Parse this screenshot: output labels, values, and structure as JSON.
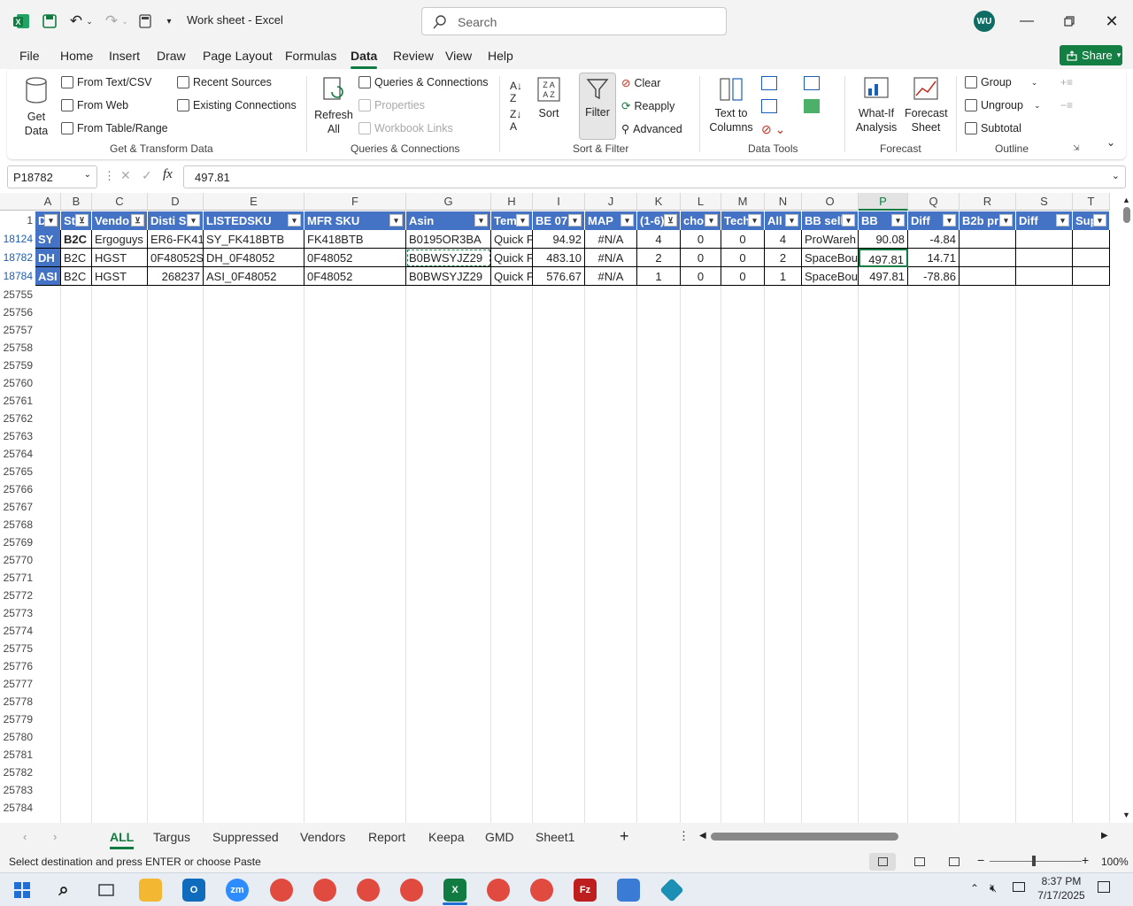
{
  "window": {
    "title": "Work sheet  -  Excel",
    "search_placeholder": "Search",
    "user_initials": "WU"
  },
  "menu": [
    "File",
    "Home",
    "Insert",
    "Draw",
    "Page Layout",
    "Formulas",
    "Data",
    "Review",
    "View",
    "Help"
  ],
  "active_menu": "Data",
  "share_label": "Share",
  "ribbon": {
    "get_data": "Get\nData",
    "from_text_csv": "From Text/CSV",
    "from_web": "From Web",
    "from_table_range": "From Table/Range",
    "recent_sources": "Recent Sources",
    "existing_connections": "Existing Connections",
    "group_get_transform": "Get & Transform Data",
    "refresh_all": "Refresh\nAll",
    "queries_connections": "Queries & Connections",
    "properties": "Properties",
    "workbook_links": "Workbook Links",
    "group_queries": "Queries & Connections",
    "sort": "Sort",
    "filter": "Filter",
    "clear": "Clear",
    "reapply": "Reapply",
    "advanced": "Advanced",
    "group_sort_filter": "Sort & Filter",
    "text_to_columns": "Text to\nColumns",
    "group_data_tools": "Data Tools",
    "what_if": "What-If\nAnalysis",
    "forecast_sheet": "Forecast\nSheet",
    "group_forecast": "Forecast",
    "group_btn": "Group",
    "ungroup": "Ungroup",
    "subtotal": "Subtotal",
    "group_outline": "Outline"
  },
  "formula_bar": {
    "name_box": "P18782",
    "formula": "497.81",
    "fx": "fx"
  },
  "columns": [
    "A",
    "B",
    "C",
    "D",
    "E",
    "F",
    "G",
    "H",
    "I",
    "J",
    "K",
    "L",
    "M",
    "N",
    "O",
    "P",
    "Q",
    "R",
    "S",
    "T"
  ],
  "header_row_number": "1",
  "headers": [
    "D",
    "St",
    "Vendo",
    "Disti S",
    "LISTEDSKU",
    "MFR SKU",
    "Asin",
    "Tem",
    "BE 07:",
    "MAP",
    "(1-6)",
    "cho",
    "Tech",
    "All",
    "BB sell",
    "BB",
    "Diff",
    "B2b pr",
    "Diff",
    "Sup"
  ],
  "rows": [
    {
      "num": "18124",
      "cells": [
        "SY",
        "B2C",
        "Ergoguys",
        "ER6-FK418",
        "SY_FK418BTB",
        "FK418BTB",
        "B0195OR3BA",
        "Quick F",
        "94.92",
        "#N/A",
        "4",
        "0",
        "0",
        "4",
        "ProWareh",
        "90.08",
        "-4.84",
        "",
        "",
        ""
      ]
    },
    {
      "num": "18782",
      "cells": [
        "DH",
        "B2C",
        "HGST",
        "0F48052SP",
        "DH_0F48052",
        "0F48052",
        "B0BWSYJZ29",
        "Quick F",
        "483.10",
        "#N/A",
        "2",
        "0",
        "0",
        "2",
        "SpaceBou",
        "497.81",
        "14.71",
        "",
        "",
        ""
      ]
    },
    {
      "num": "18784",
      "cells": [
        "ASI",
        "B2C",
        "HGST",
        "268237",
        "ASI_0F48052",
        "0F48052",
        "B0BWSYJZ29",
        "Quick F",
        "576.67",
        "#N/A",
        "1",
        "0",
        "0",
        "1",
        "SpaceBou",
        "497.81",
        "-78.86",
        "",
        "",
        ""
      ]
    }
  ],
  "empty_rows": [
    "25755",
    "25756",
    "25757",
    "25758",
    "25759",
    "25760",
    "25761",
    "25762",
    "25763",
    "25764",
    "25765",
    "25766",
    "25767",
    "25768",
    "25769",
    "25770",
    "25771",
    "25772",
    "25773",
    "25774",
    "25775",
    "25776",
    "25777",
    "25778",
    "25779",
    "25780",
    "25781",
    "25782",
    "25783",
    "25784"
  ],
  "sheet_tabs": [
    "ALL",
    "Targus",
    "Suppressed",
    "Vendors",
    "Report",
    "Keepa",
    "GMD",
    "Sheet1"
  ],
  "active_tab": "ALL",
  "status": {
    "message": "Select destination and press ENTER or choose Paste",
    "zoom": "100%"
  },
  "taskbar": {
    "time": "8:37 PM",
    "date": "7/17/2025"
  },
  "colors": {
    "excel_green": "#107c41",
    "header_blue": "#4472c4"
  }
}
